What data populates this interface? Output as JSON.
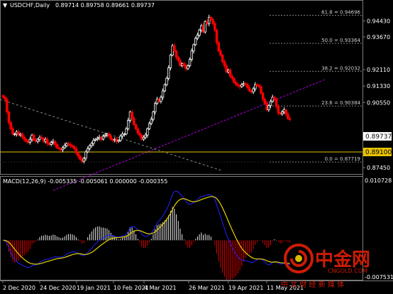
{
  "header": {
    "arrow": "▼",
    "symbol": "USDCHF,Daily",
    "ohlc": "0.89714 0.89758 0.89661 0.89737"
  },
  "macd_title": "MACD(12,26,9) -0.005335 -0.005061 0.000000 -0.000355",
  "price_axis": {
    "ticks": [
      "0.94430",
      "0.93670",
      "0.92110",
      "0.91330",
      "0.90550",
      "0.88230",
      "0.87450"
    ],
    "current_price": "0.89737",
    "hline_price": "0.89100"
  },
  "macd_axis": {
    "top": "0.010728",
    "bottom": "-0.007531"
  },
  "fib_levels": [
    {
      "label": "61.8 = 0.94696",
      "ratio": 61.8,
      "price": 0.94696
    },
    {
      "label": "50.0 = 0.93364",
      "ratio": 50.0,
      "price": 0.93364
    },
    {
      "label": "38.2 = 0.92032",
      "ratio": 38.2,
      "price": 0.92032
    },
    {
      "label": "23.6 = 0.90384",
      "ratio": 23.6,
      "price": 0.90384
    },
    {
      "label": "0.0 = 0.87719",
      "ratio": 0.0,
      "price": 0.87719
    }
  ],
  "x_axis": [
    "2 Dec 2020",
    "24 Dec 2020",
    "19 Jan 2021",
    "10 Feb 2021",
    "4 Mar 2021",
    "26 Mar 2021",
    "19 Apr 2021",
    "11 May 2021"
  ],
  "watermark": {
    "brand": "中金网",
    "domain": "CNGOLD.COM",
    "slogan": "中 文 财 经 新 媒 体"
  },
  "colors": {
    "background": "#000000",
    "grid": "#3a3a3a",
    "bull": "#ffffff",
    "bear": "#ff0000",
    "hline": "#e6c200",
    "trend": "#b000e0",
    "fib": "#808080",
    "macd_signal": "#e6d200",
    "macd_main": "#2020ff",
    "watermark": "#d81e06"
  },
  "chart_data": {
    "type": "candlestick",
    "symbol": "USDCHF",
    "timeframe": "Daily",
    "y_range": [
      0.8715,
      0.9495
    ],
    "annotations": [
      "horizontal line 0.89100",
      "fibonacci retracement 0.87719–0.94696",
      "ascending trendline",
      "descending trendline"
    ],
    "series": [
      {
        "name": "USDCHF",
        "values": [
          0.908,
          0.907,
          0.901,
          0.896,
          0.893,
          0.8905,
          0.8905,
          0.8915,
          0.89,
          0.8905,
          0.889,
          0.888,
          0.887,
          0.8865,
          0.888,
          0.89,
          0.8875,
          0.887,
          0.888,
          0.889,
          0.8885,
          0.887,
          0.888,
          0.886,
          0.8855,
          0.8865,
          0.887,
          0.8855,
          0.884,
          0.8835,
          0.883,
          0.884,
          0.885,
          0.886,
          0.8855,
          0.885,
          0.8845,
          0.8835,
          0.8815,
          0.88,
          0.8785,
          0.8775,
          0.879,
          0.882,
          0.8835,
          0.885,
          0.886,
          0.8875,
          0.888,
          0.8885,
          0.889,
          0.888,
          0.8895,
          0.89,
          0.8905,
          0.8895,
          0.888,
          0.8875,
          0.888,
          0.887,
          0.8875,
          0.8895,
          0.8905,
          0.8905,
          0.893,
          0.897,
          0.901,
          0.898,
          0.895,
          0.893,
          0.891,
          0.89,
          0.888,
          0.889,
          0.89,
          0.893,
          0.8955,
          0.8975,
          0.901,
          0.905,
          0.907,
          0.906,
          0.908,
          0.911,
          0.914,
          0.917,
          0.922,
          0.928,
          0.9325,
          0.93,
          0.927,
          0.9255,
          0.923,
          0.924,
          0.923,
          0.9215,
          0.923,
          0.926,
          0.93,
          0.933,
          0.936,
          0.9375,
          0.94,
          0.942,
          0.939,
          0.944,
          0.943,
          0.946,
          0.945,
          0.943,
          0.94,
          0.934,
          0.93,
          0.928,
          0.925,
          0.923,
          0.92,
          0.921,
          0.918,
          0.917,
          0.915,
          0.914,
          0.9135,
          0.913,
          0.914,
          0.9145,
          0.914,
          0.9125,
          0.911,
          0.9105,
          0.912,
          0.914,
          0.9135,
          0.913,
          0.91,
          0.907,
          0.905,
          0.902,
          0.904,
          0.906,
          0.908,
          0.907,
          0.9035,
          0.9005,
          0.9,
          0.901,
          0.902,
          0.9,
          0.8978,
          0.8974
        ]
      }
    ],
    "macd": {
      "params": [
        12,
        26,
        9
      ],
      "values": [
        -0.005335,
        -0.005061,
        0.0,
        -0.000355
      ],
      "y_range": [
        -0.007531,
        0.010728
      ]
    }
  }
}
